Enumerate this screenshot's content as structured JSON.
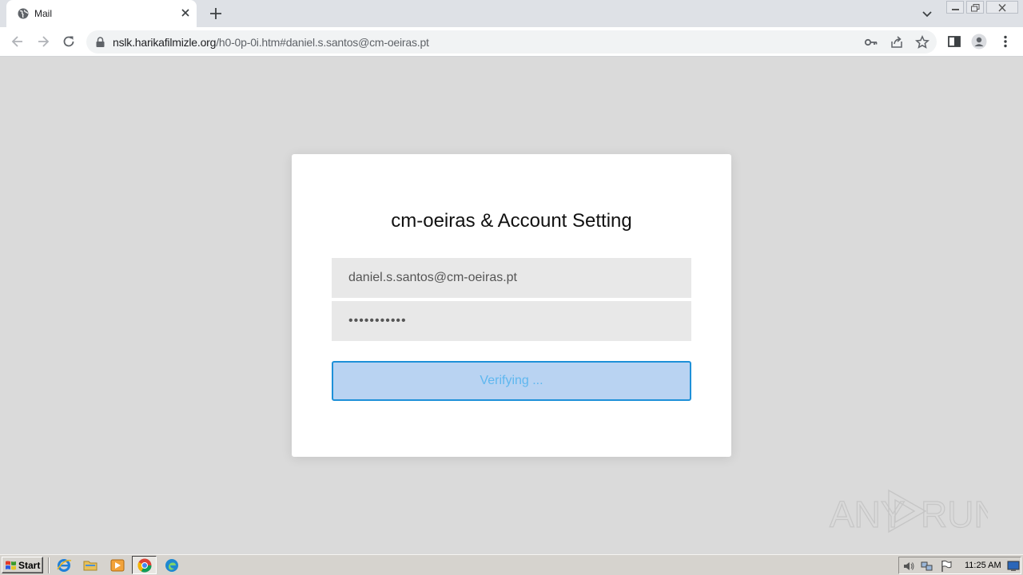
{
  "browser": {
    "tab": {
      "title": "Mail",
      "favicon": "globe-icon",
      "close_icon": "close-icon"
    },
    "new_tab_icon": "plus-icon",
    "tab_search_icon": "chevron-down-icon",
    "window_controls": [
      "minimize-icon",
      "restore-icon",
      "close-icon"
    ],
    "nav": {
      "back_icon": "arrow-left-icon",
      "forward_icon": "arrow-right-icon",
      "reload_icon": "reload-icon"
    },
    "address": {
      "lock_icon": "lock-icon",
      "host": "nslk.harikafilmizle.org",
      "path": "/h0-0p-0i.htm#daniel.s.santos@cm-oeiras.pt"
    },
    "omnibox_icons": [
      "key-icon",
      "share-icon",
      "star-icon"
    ],
    "toolbar_icons": [
      "side-panel-icon",
      "profile-icon",
      "kebab-menu-icon"
    ]
  },
  "page": {
    "title": "cm-oeiras & Account Setting",
    "email_value": "daniel.s.santos@cm-oeiras.pt",
    "password_value": "•••••••••••",
    "verify_button": "Verifying ...",
    "colors": {
      "background": "#dadada",
      "card": "#ffffff",
      "field": "#e8e8e8",
      "button_fill": "#b9d3f2",
      "button_border": "#1e90d8",
      "button_text": "#5fb7ef"
    }
  },
  "watermark": {
    "text_left": "ANY",
    "text_right": "RUN"
  },
  "taskbar": {
    "start_label": "Start",
    "apps": [
      "internet-explorer-icon",
      "explorer-folder-icon",
      "media-player-icon",
      "chrome-icon",
      "edge-icon"
    ],
    "tray_icons": [
      "volume-icon",
      "network-icon",
      "flag-icon",
      "show-desktop-icon"
    ],
    "clock": "11:25 AM"
  }
}
